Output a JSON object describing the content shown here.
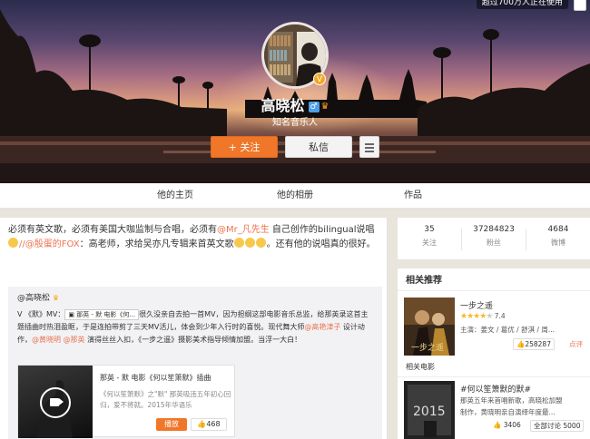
{
  "cover": {
    "live_tag": "超过700万人正在使用",
    "profile_name": "高晓松",
    "gender_icon": "male-icon",
    "subtitle": "知名音乐人",
    "follow_label": "+ 关注",
    "message_label": "私信"
  },
  "tabs": [
    "他的主页",
    "他的相册",
    "作品"
  ],
  "post": {
    "segments": [
      {
        "text": "必须有英文歌，必须有美国大咖监制与合唱，必须有",
        "link": false
      },
      {
        "text": "@Mr_凡先生",
        "link": true
      },
      {
        "text": " 自己创作的bilingual说唱",
        "link": false
      },
      {
        "text": "//@殷蛋的FOX",
        "link": true
      },
      {
        "text": "：高老师，求给吴亦凡专辑来首英文歌",
        "link": false
      },
      {
        "text": "。还有他的说唱真的很好。",
        "link": false
      }
    ],
    "repost": {
      "author": "@高晓松",
      "mv_tag": "那英 - 默 电影《何...",
      "text_parts": [
        {
          "text": "Ⅴ 《默》MV：",
          "link": false
        },
        {
          "text": "很久没亲自去拍一首MV，因为担纲这部电影音乐总监，给那英录这首主题插曲时热泪盈眶，于是连拍带剪了三天MV活儿，体会到少年入行时的喜悦。现代舞大师",
          "link": false
        },
        {
          "text": "@高艳津子",
          "link": true
        },
        {
          "text": " 设计动作，",
          "link": false
        },
        {
          "text": "@黄晓明",
          "link": true
        },
        {
          "text": " ",
          "link": false
        },
        {
          "text": "@那英",
          "link": true
        },
        {
          "text": " 演得丝丝入扣，《一步之遥》摄影美术指导倾情加盟。当浮一大白！",
          "link": false
        }
      ],
      "card": {
        "title": "那英 - 默 电影《何以笙箫默》插曲",
        "desc": "《何以笙箫默》之\"默\" 那英吸违五年初心回归，爱不将就。2015年华语乐",
        "play_label": "播放",
        "likes": "468"
      }
    }
  },
  "stats": [
    {
      "number": "35",
      "label": "关注"
    },
    {
      "number": "37284823",
      "label": "粉丝"
    },
    {
      "number": "4684",
      "label": "微博"
    }
  ],
  "recommend": {
    "title": "相关推荐",
    "items": [
      {
        "title": "一步之遥",
        "rating": 3.5,
        "score": "7.4",
        "cast": "主演：姜文 / 葛优 / 舒淇 / 周...",
        "likes": "258287",
        "extra": "点评"
      }
    ],
    "section_label": "相关电影",
    "topic": {
      "title": "#何以笙箫默的默#",
      "desc_line1": "那英五年来首唱新歌，高晓松加盟",
      "desc_line2": "制作，黄晓明亲自演绎年度最...",
      "likes": "3406",
      "discuss": "全部讨论 5000"
    }
  }
}
